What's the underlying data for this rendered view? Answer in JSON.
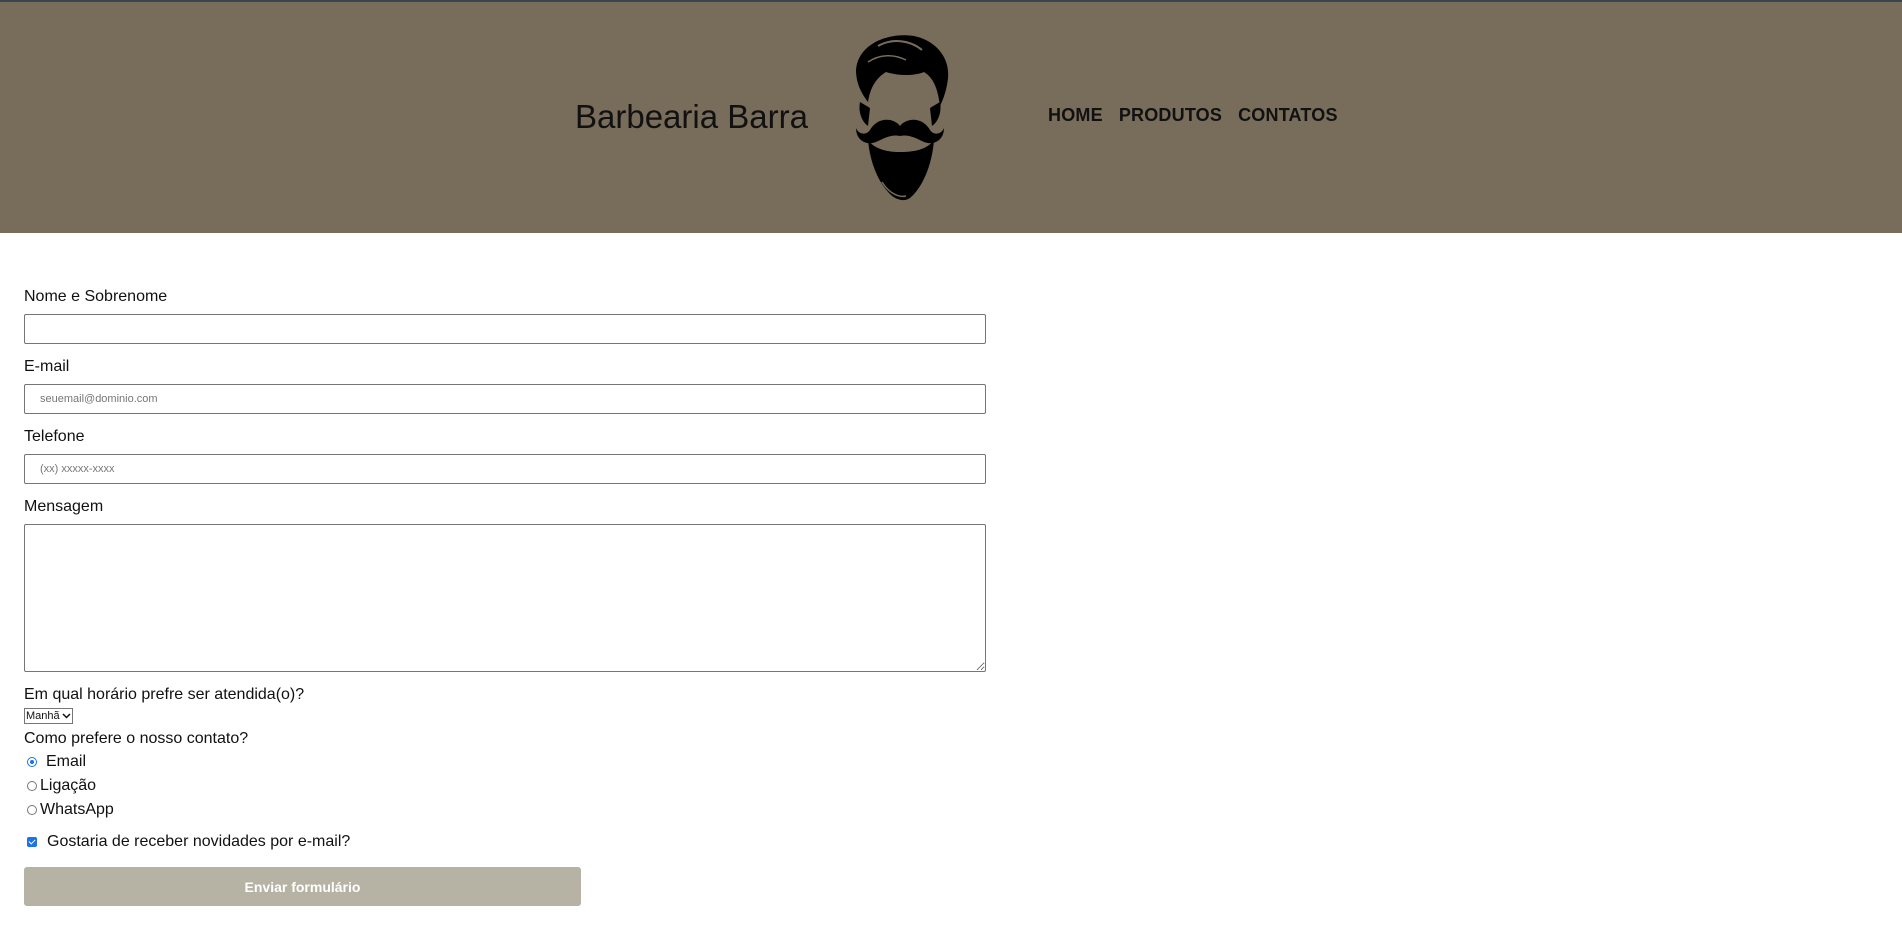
{
  "header": {
    "brand": "Barbearia Barra",
    "logo_icon": "bearded-man-icon",
    "nav": [
      {
        "label": "HOME"
      },
      {
        "label": "PRODUTOS"
      },
      {
        "label": "CONTATOS"
      }
    ]
  },
  "form": {
    "name_label": "Nome e Sobrenome",
    "name_value": "",
    "email_label": "E-mail",
    "email_placeholder": "seuemail@dominio.com",
    "phone_label": "Telefone",
    "phone_placeholder": "(xx) xxxxx-xxxx",
    "message_label": "Mensagem",
    "schedule_label": "Em qual horário prefre ser atendida(o)?",
    "schedule_selected": "Manhã",
    "contact_label": "Como prefere o nosso contato?",
    "contact_options": [
      {
        "label": "Email",
        "selected": true
      },
      {
        "label": "Ligação",
        "selected": false
      },
      {
        "label": "WhatsApp",
        "selected": false
      }
    ],
    "newsletter_label": "Gostaria de receber novidades por e-mail?",
    "newsletter_checked": true,
    "submit_label": "Enviar formulário"
  },
  "colors": {
    "header_bg": "#786c5a",
    "button_bg": "#b6b2a4",
    "accent": "#1a73e8"
  }
}
